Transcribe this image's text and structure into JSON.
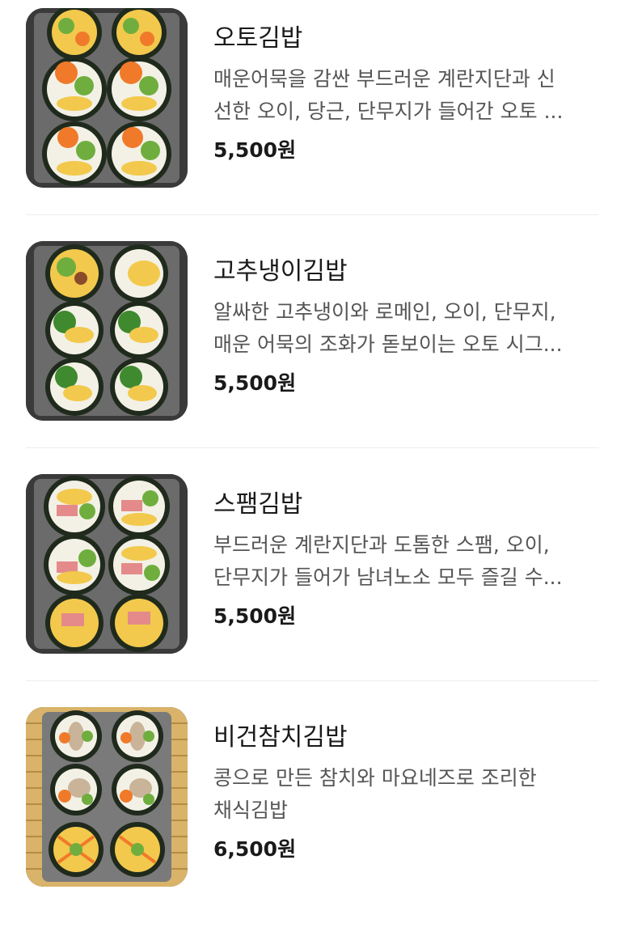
{
  "menu": {
    "items": [
      {
        "name": "오토김밥",
        "desc_line1": "매운어묵을 감싼 부드러운 계란지단과 신",
        "desc_line2": "선한 오이, 당근, 단무지가 들어간 오토 ...",
        "price": "5,500원",
        "image": "kimbap-photo"
      },
      {
        "name": "고추냉이김밥",
        "desc_line1": "알싸한 고추냉이와 로메인, 오이, 단무지,",
        "desc_line2": "매운 어묵의 조화가 돋보이는 오토 시그...",
        "price": "5,500원",
        "image": "kimbap-photo"
      },
      {
        "name": "스팸김밥",
        "desc_line1": "부드러운 계란지단과 도톰한 스팸, 오이,",
        "desc_line2": "단무지가 들어가 남녀노소 모두 즐길 수...",
        "price": "5,500원",
        "image": "kimbap-photo"
      },
      {
        "name": "비건참치김밥",
        "desc_line1": "콩으로 만든 참치와 마요네즈로 조리한",
        "desc_line2": "채식김밥",
        "price": "6,500원",
        "image": "kimbap-photo"
      }
    ]
  },
  "colors": {
    "seaweed": "#1f2a1c",
    "rice": "#f3f1e6",
    "egg": "#f2c94c",
    "cucumber": "#6fae3e",
    "carrot": "#f07a2a",
    "spam": "#e58a8a",
    "tray": "#5a5a5a",
    "bamboo": "#d9b36a"
  }
}
